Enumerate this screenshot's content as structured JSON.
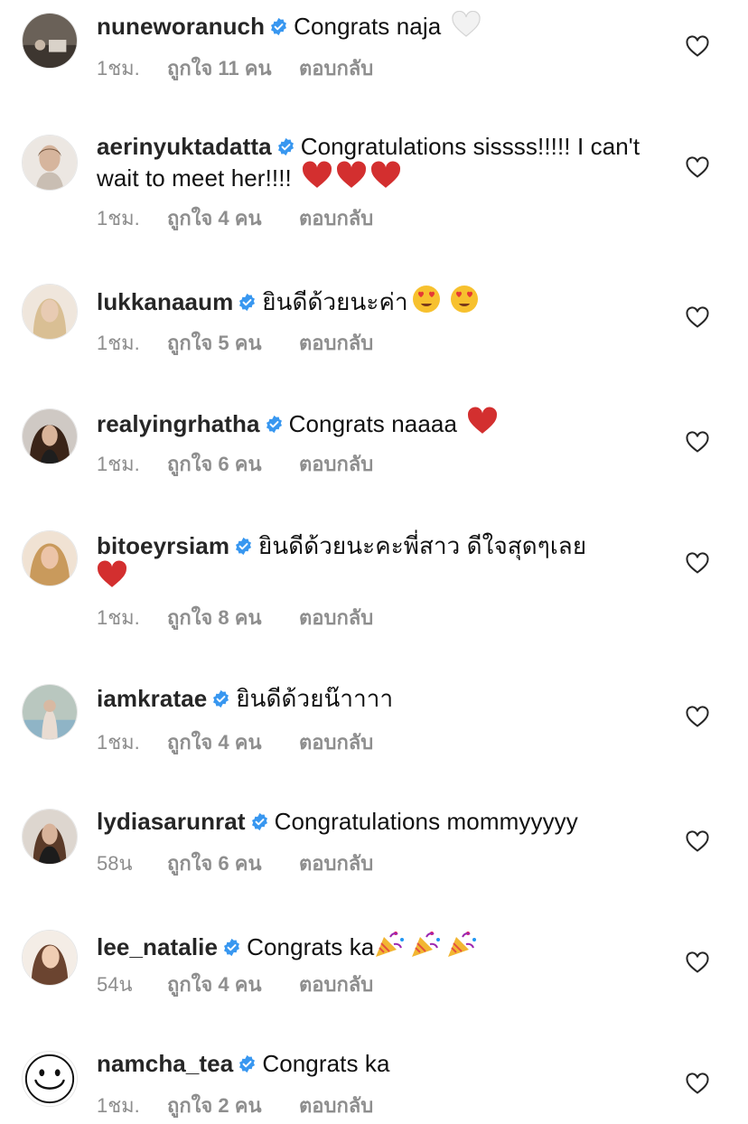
{
  "colors": {
    "verified_badge": "#3897f0",
    "meta_text": "#8e8e8e",
    "red_heart": "#d32f2f"
  },
  "comments": [
    {
      "username": "nuneworanuch",
      "text": "Congrats naja",
      "emoji": [
        "white-heart-emoji"
      ],
      "time": "1ชม.",
      "likes": "ถูกใจ 11 คน",
      "reply": "ตอบกลับ"
    },
    {
      "username": "aerinyuktadatta",
      "text": "Congratulations sissss!!!!! I can't wait to meet her!!!!",
      "emoji": [
        "red-heart-emoji",
        "red-heart-emoji",
        "red-heart-emoji"
      ],
      "time": "1ชม.",
      "likes": "ถูกใจ 4 คน",
      "reply": "ตอบกลับ"
    },
    {
      "username": "lukkanaaum",
      "text": "ยินดีด้วยนะค่า",
      "emoji": [
        "heart-eyes-emoji",
        "heart-eyes-emoji"
      ],
      "time": "1ชม.",
      "likes": "ถูกใจ 5 คน",
      "reply": "ตอบกลับ"
    },
    {
      "username": "realyingrhatha",
      "text": "Congrats naaaa",
      "emoji": [
        "red-heart-emoji"
      ],
      "time": "1ชม.",
      "likes": "ถูกใจ 6 คน",
      "reply": "ตอบกลับ"
    },
    {
      "username": "bitoeyrsiam",
      "text": "ยินดีด้วยนะคะพี่สาว ดีใจสุดๆเลย",
      "emoji": [
        "red-heart-emoji"
      ],
      "time": "1ชม.",
      "likes": "ถูกใจ 8 คน",
      "reply": "ตอบกลับ"
    },
    {
      "username": "iamkratae",
      "text": "ยินดีด้วยน๊าาาา",
      "emoji": [],
      "time": "1ชม.",
      "likes": "ถูกใจ 4 คน",
      "reply": "ตอบกลับ"
    },
    {
      "username": "lydiasarunrat",
      "text": "Congratulations mommyyyyy",
      "emoji": [],
      "time": "58น",
      "likes": "ถูกใจ 6 คน",
      "reply": "ตอบกลับ"
    },
    {
      "username": "lee_natalie",
      "text": "Congrats ka",
      "emoji": [
        "party-popper-emoji",
        "party-popper-emoji",
        "party-popper-emoji"
      ],
      "time": "54น",
      "likes": "ถูกใจ 4 คน",
      "reply": "ตอบกลับ"
    },
    {
      "username": "namcha_tea",
      "text": "Congrats ka",
      "emoji": [],
      "time": "1ชม.",
      "likes": "ถูกใจ 2 คน",
      "reply": "ตอบกลับ"
    }
  ]
}
